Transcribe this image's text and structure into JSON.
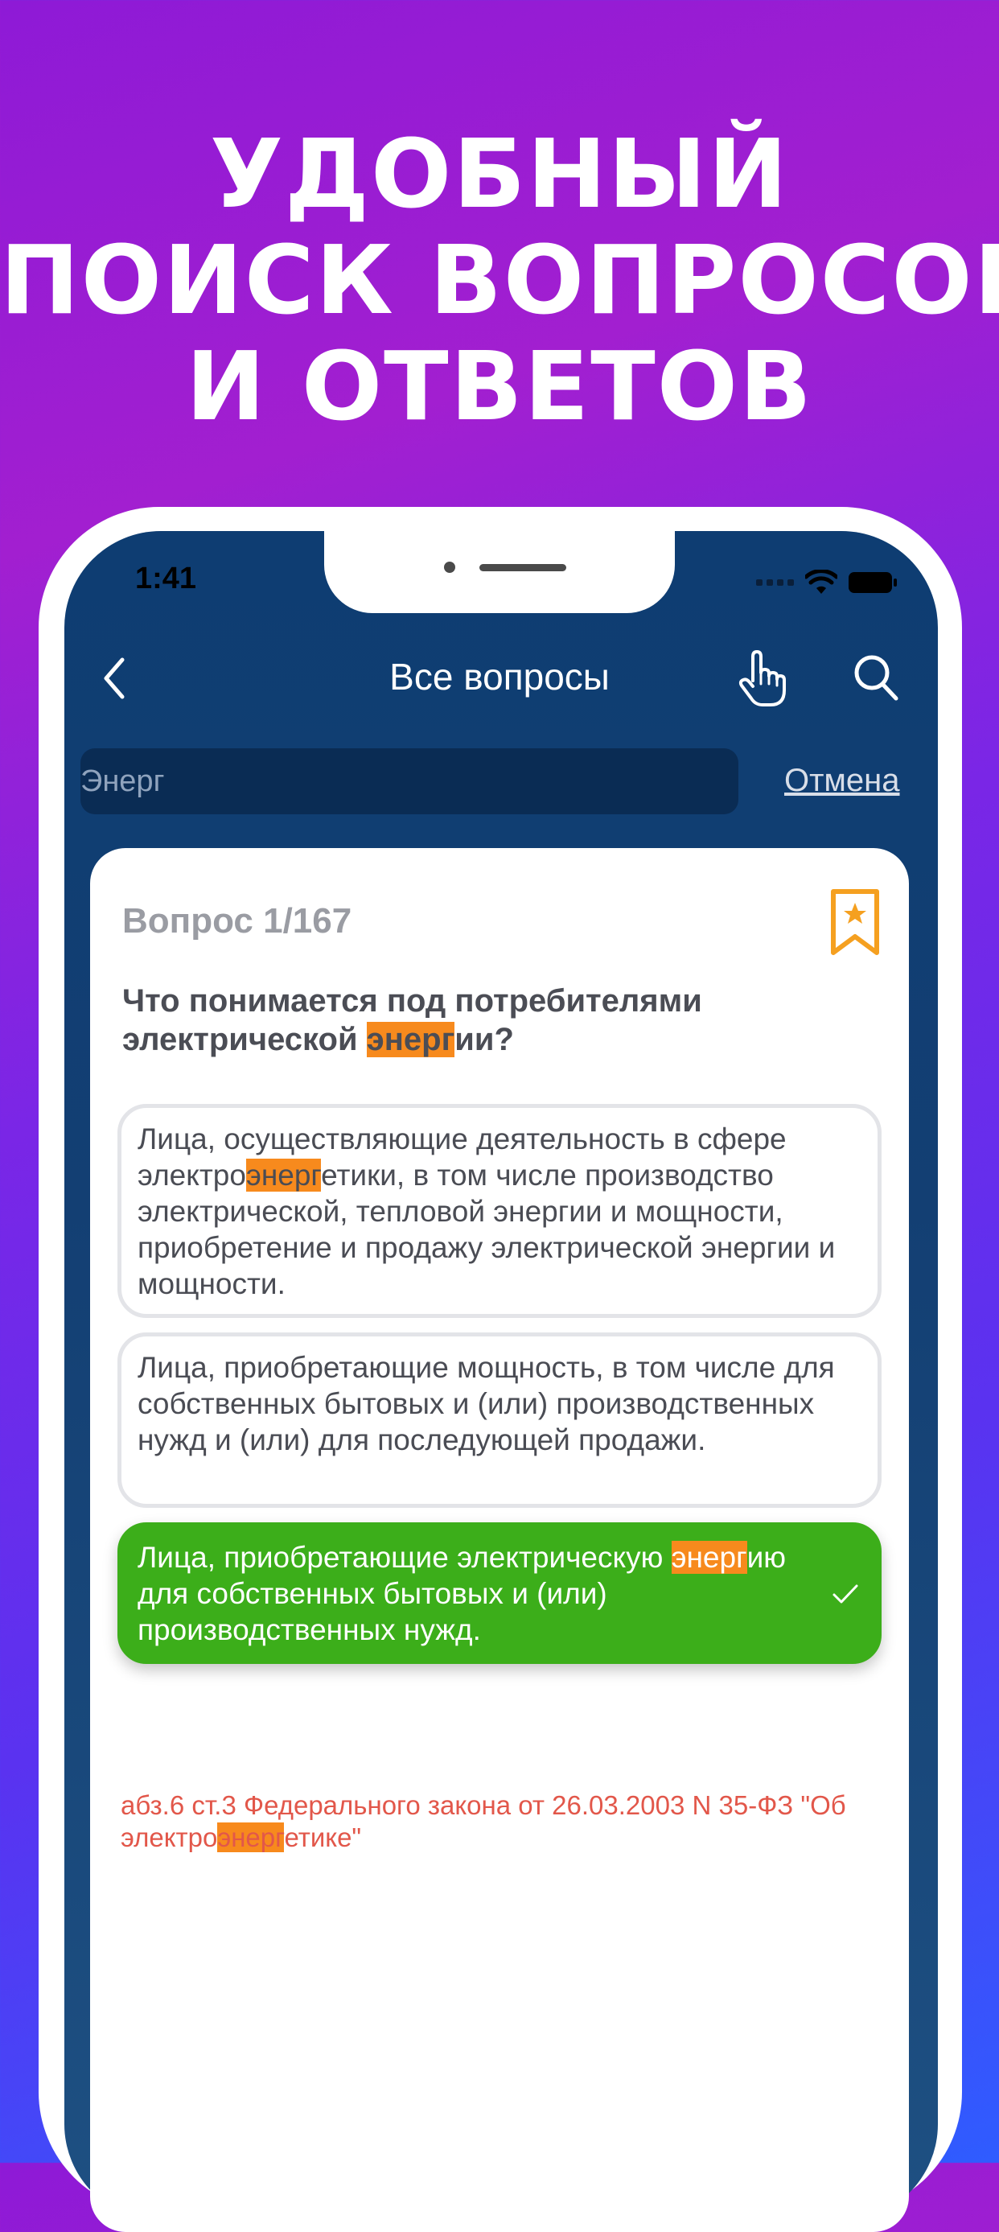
{
  "promo": {
    "line1": "УДОБНЫЙ",
    "line2": "ПОИСК ВОПРОСОВ",
    "line3": "И ОТВЕТОВ"
  },
  "status_bar": {
    "time": "1:41"
  },
  "nav": {
    "title": "Все вопросы"
  },
  "search": {
    "value": "Энерг",
    "cancel_label": "Отмена"
  },
  "question": {
    "counter": "Вопрос 1/167",
    "text_before": "Что понимается под потребителями электрической ",
    "text_highlight": "энерг",
    "text_after": "ии?"
  },
  "answers": [
    {
      "before": "Лица, осуществляющие деятельность в сфере электро",
      "highlight": "энерг",
      "after": "етики, в том числе производство электрической, тепловой энергии и мощности, приобретение и продажу электрической энергии и мощности.",
      "correct": false
    },
    {
      "before": "Лица, приобретающие мощность, в том числе для собственных бытовых и (или) производственных нужд и (или) для последующей продажи.",
      "highlight": "",
      "after": "",
      "correct": false
    },
    {
      "before": "Лица, приобретающие электрическую ",
      "highlight": "энерг",
      "after": "ию для собственных бытовых и (или) производственных нужд.",
      "correct": true
    }
  ],
  "source": {
    "before": "абз.6 ст.3 Федерального закона от 26.03.2003 N 35-ФЗ \"Об электро",
    "highlight": "энерг",
    "after": "етике\""
  },
  "colors": {
    "accent_orange": "#f78a1d",
    "correct_green": "#3cae1a",
    "header_blue": "#0e3d72",
    "source_red": "#e2574a"
  },
  "icons": [
    "back-chevron-icon",
    "hand-pointer-icon",
    "search-icon",
    "bookmark-star-icon",
    "checkmark-icon",
    "wifi-icon",
    "battery-icon"
  ]
}
